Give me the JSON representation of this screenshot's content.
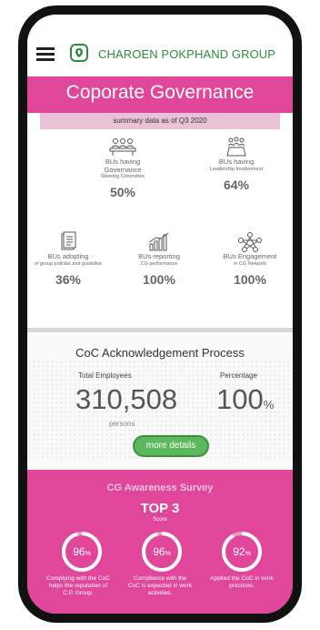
{
  "header": {
    "brand": "CHAROEN POKPHAND GROUP"
  },
  "page_title": "Coporate Governance",
  "summary": "summary data as of Q3 2020",
  "governance": [
    {
      "icon": "committee-icon",
      "label": "BUs having Governance",
      "sub": "Steering Committee",
      "value": "50%"
    },
    {
      "icon": "leadership-icon",
      "label": "BUs having",
      "sub": "Leadership Involvement",
      "value": "64%"
    },
    {
      "icon": "document-icon",
      "label": "BUs adopting",
      "sub": "of group policies and guideline",
      "value": "36%"
    },
    {
      "icon": "bar-chart-icon",
      "label": "BUs reporting",
      "sub": "CG performance",
      "value": "100%"
    },
    {
      "icon": "network-icon",
      "label": "BUs Engagement",
      "sub": "in CG Network",
      "value": "100%"
    }
  ],
  "coc": {
    "title": "CoC Acknowledgement Process",
    "total_label": "Total Employees",
    "total_value": "310,508",
    "persons_label": "persons",
    "percentage_label": "Percentage",
    "percentage_value": "100",
    "percentage_unit": "%",
    "button": "more details"
  },
  "survey": {
    "title": "CG Awareness Survey",
    "headline": "TOP 3",
    "score_label": "Score",
    "items": [
      {
        "value": "96",
        "unit": "%",
        "caption": "Complying with the CoC helps the reputation of C.P. Group.",
        "fraction": 0.96
      },
      {
        "value": "96",
        "unit": "%",
        "caption": "Compliance with the CoC is expected in work activities.",
        "fraction": 0.96
      },
      {
        "value": "92",
        "unit": "%",
        "caption": "Applied the CoC in work practices.",
        "fraction": 0.92
      }
    ]
  },
  "colors": {
    "accent": "#e0469a",
    "brand_green": "#2e8b3e",
    "button_green": "#5cb85c"
  }
}
